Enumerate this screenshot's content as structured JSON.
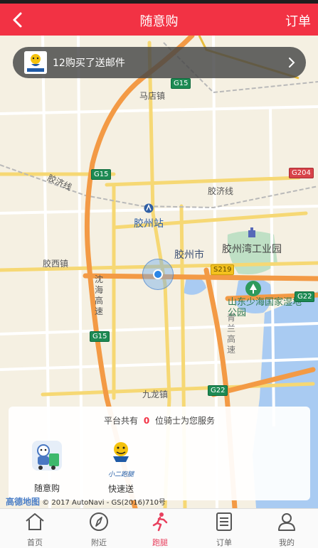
{
  "header": {
    "title": "随意购",
    "orders_link": "订单"
  },
  "banner": {
    "text": "12购买了送邮件",
    "logo_text": "小二跑腿"
  },
  "map": {
    "labels": {
      "majiazhen": "马店镇",
      "jiaoji_w": "胶济线",
      "jiaoji_e": "胶济线",
      "station": "胶州站",
      "city": "胶州市",
      "industrial": "胶州湾工业园",
      "jiaoxi": "胶西镇",
      "shenhai": "沈海高速",
      "qingsan": "青兰高速",
      "wetland": "山东少海国家湿地公园",
      "jiulong": "九龙镇",
      "village": "胶莱西南名胜区"
    },
    "shields": {
      "g15_top": "G15",
      "g15_mid": "G15",
      "g15_bot": "G15",
      "g204": "G204",
      "s219": "S219",
      "g22_r": "G22",
      "g22_b": "G22"
    },
    "attribution": {
      "brand": "高德地图",
      "text": "© 2017 AutoNavi - GS(2016)710号"
    }
  },
  "card": {
    "info_prefix": "平台共有",
    "rider_count": "0",
    "info_suffix": "位骑士为您服务",
    "services": [
      {
        "label": "随意购",
        "icon": "shopping-courier-icon"
      },
      {
        "label": "快速送",
        "icon": "xiaoer-paotui-icon"
      }
    ],
    "logo_text": "小二跑腿"
  },
  "tabs": [
    {
      "label": "首页",
      "icon": "home-icon"
    },
    {
      "label": "附近",
      "icon": "compass-icon"
    },
    {
      "label": "跑腿",
      "icon": "runner-icon",
      "active": true
    },
    {
      "label": "订单",
      "icon": "order-list-icon"
    },
    {
      "label": "我的",
      "icon": "user-icon"
    }
  ],
  "colors": {
    "brand_red": "#f23244",
    "active_tab": "#e8405e",
    "locate_blue": "#2b86e6"
  }
}
